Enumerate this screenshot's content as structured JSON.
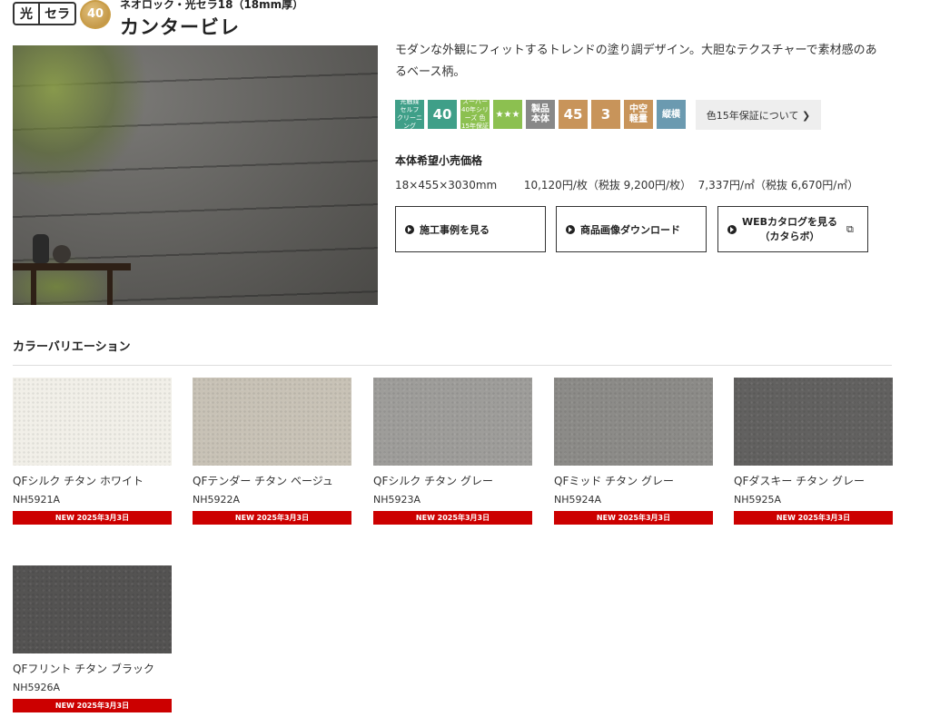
{
  "header": {
    "badge_hikari": [
      "光",
      "セラ"
    ],
    "badge_40": "40",
    "subtitle": "ネオロック・光セラ18（18mm厚）",
    "title": "カンタービレ"
  },
  "description": "モダンな外観にフィットするトレンドの塗り調デザイン。大胆なテクスチャーで素材感のあるベース柄。",
  "feature_icons": [
    {
      "text": "光触媒 セルフ クリーニング",
      "color": "#3f9f88",
      "size": "small"
    },
    {
      "text": "40",
      "color": "#3f9f88",
      "size": "big"
    },
    {
      "text": "スーパー 40年シリーズ 色15年保証",
      "color": "#8cc050",
      "size": "small"
    },
    {
      "text": "★★★",
      "color": "#8cc050",
      "size": "mid"
    },
    {
      "text": "製品 本体",
      "color": "#888888",
      "size": "mid"
    },
    {
      "text": "45",
      "color": "#c8945a",
      "size": "big"
    },
    {
      "text": "3",
      "color": "#c8945a",
      "size": "big"
    },
    {
      "text": "中空 軽量",
      "color": "#c8945a",
      "size": "mid"
    },
    {
      "text": "縦横",
      "color": "#6b9ab0",
      "size": "mid"
    }
  ],
  "warranty_button": "色15年保証について ❯",
  "price": {
    "heading": "本体希望小売価格",
    "size": "18×455×3030mm",
    "per_piece": "10,120円/枚（税抜 9,200円/枚）",
    "per_sqm": "7,337円/㎡（税抜 6,670円/㎡）"
  },
  "buttons": {
    "cases": "施工事例を見る",
    "download": "商品画像ダウンロード",
    "catalog_line1": "WEBカタログを見る",
    "catalog_line2": "（カタらボ）",
    "external_icon": "⧉"
  },
  "color_variation": {
    "title": "カラーバリエーション",
    "items": [
      {
        "name": "QFシルク チタン ホワイト",
        "code": "NH5921A",
        "badge": "NEW 2025年3月3日",
        "color": "#f1efe8"
      },
      {
        "name": "QFテンダー チタン ベージュ",
        "code": "NH5922A",
        "badge": "NEW 2025年3月3日",
        "color": "#c8c2b6"
      },
      {
        "name": "QFシルク チタン グレー",
        "code": "NH5923A",
        "badge": "NEW 2025年3月3日",
        "color": "#9e9d9a"
      },
      {
        "name": "QFミッド チタン グレー",
        "code": "NH5924A",
        "badge": "NEW 2025年3月3日",
        "color": "#8c8b88"
      },
      {
        "name": "QFダスキー チタン グレー",
        "code": "NH5925A",
        "badge": "NEW 2025年3月3日",
        "color": "#626160"
      },
      {
        "name": "QFフリント チタン ブラック",
        "code": "NH5926A",
        "badge": "NEW 2025年3月3日",
        "color": "#545352"
      }
    ]
  }
}
